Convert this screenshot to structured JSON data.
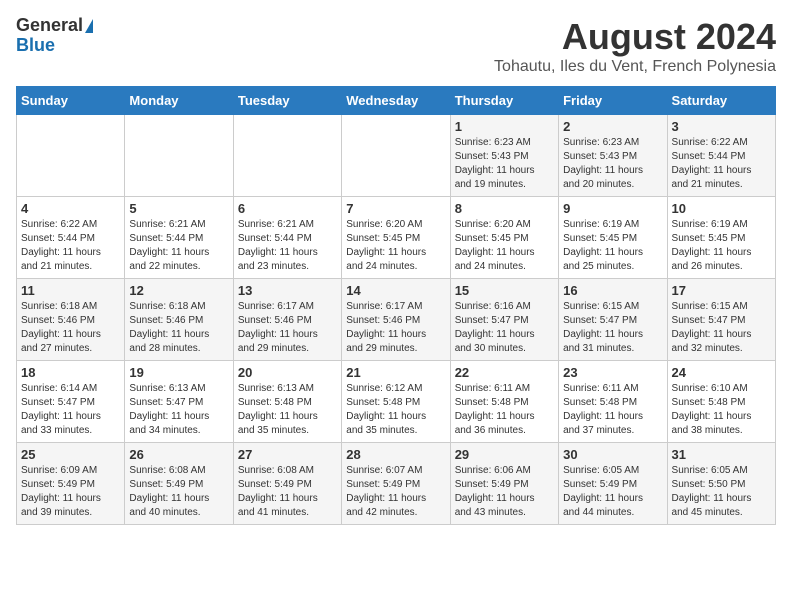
{
  "logo": {
    "general": "General",
    "blue": "Blue"
  },
  "title": "August 2024",
  "subtitle": "Tohautu, Iles du Vent, French Polynesia",
  "days": [
    "Sunday",
    "Monday",
    "Tuesday",
    "Wednesday",
    "Thursday",
    "Friday",
    "Saturday"
  ],
  "weeks": [
    [
      {
        "date": "",
        "info": ""
      },
      {
        "date": "",
        "info": ""
      },
      {
        "date": "",
        "info": ""
      },
      {
        "date": "",
        "info": ""
      },
      {
        "date": "1",
        "info": "Sunrise: 6:23 AM\nSunset: 5:43 PM\nDaylight: 11 hours\nand 19 minutes."
      },
      {
        "date": "2",
        "info": "Sunrise: 6:23 AM\nSunset: 5:43 PM\nDaylight: 11 hours\nand 20 minutes."
      },
      {
        "date": "3",
        "info": "Sunrise: 6:22 AM\nSunset: 5:44 PM\nDaylight: 11 hours\nand 21 minutes."
      }
    ],
    [
      {
        "date": "4",
        "info": "Sunrise: 6:22 AM\nSunset: 5:44 PM\nDaylight: 11 hours\nand 21 minutes."
      },
      {
        "date": "5",
        "info": "Sunrise: 6:21 AM\nSunset: 5:44 PM\nDaylight: 11 hours\nand 22 minutes."
      },
      {
        "date": "6",
        "info": "Sunrise: 6:21 AM\nSunset: 5:44 PM\nDaylight: 11 hours\nand 23 minutes."
      },
      {
        "date": "7",
        "info": "Sunrise: 6:20 AM\nSunset: 5:45 PM\nDaylight: 11 hours\nand 24 minutes."
      },
      {
        "date": "8",
        "info": "Sunrise: 6:20 AM\nSunset: 5:45 PM\nDaylight: 11 hours\nand 24 minutes."
      },
      {
        "date": "9",
        "info": "Sunrise: 6:19 AM\nSunset: 5:45 PM\nDaylight: 11 hours\nand 25 minutes."
      },
      {
        "date": "10",
        "info": "Sunrise: 6:19 AM\nSunset: 5:45 PM\nDaylight: 11 hours\nand 26 minutes."
      }
    ],
    [
      {
        "date": "11",
        "info": "Sunrise: 6:18 AM\nSunset: 5:46 PM\nDaylight: 11 hours\nand 27 minutes."
      },
      {
        "date": "12",
        "info": "Sunrise: 6:18 AM\nSunset: 5:46 PM\nDaylight: 11 hours\nand 28 minutes."
      },
      {
        "date": "13",
        "info": "Sunrise: 6:17 AM\nSunset: 5:46 PM\nDaylight: 11 hours\nand 29 minutes."
      },
      {
        "date": "14",
        "info": "Sunrise: 6:17 AM\nSunset: 5:46 PM\nDaylight: 11 hours\nand 29 minutes."
      },
      {
        "date": "15",
        "info": "Sunrise: 6:16 AM\nSunset: 5:47 PM\nDaylight: 11 hours\nand 30 minutes."
      },
      {
        "date": "16",
        "info": "Sunrise: 6:15 AM\nSunset: 5:47 PM\nDaylight: 11 hours\nand 31 minutes."
      },
      {
        "date": "17",
        "info": "Sunrise: 6:15 AM\nSunset: 5:47 PM\nDaylight: 11 hours\nand 32 minutes."
      }
    ],
    [
      {
        "date": "18",
        "info": "Sunrise: 6:14 AM\nSunset: 5:47 PM\nDaylight: 11 hours\nand 33 minutes."
      },
      {
        "date": "19",
        "info": "Sunrise: 6:13 AM\nSunset: 5:47 PM\nDaylight: 11 hours\nand 34 minutes."
      },
      {
        "date": "20",
        "info": "Sunrise: 6:13 AM\nSunset: 5:48 PM\nDaylight: 11 hours\nand 35 minutes."
      },
      {
        "date": "21",
        "info": "Sunrise: 6:12 AM\nSunset: 5:48 PM\nDaylight: 11 hours\nand 35 minutes."
      },
      {
        "date": "22",
        "info": "Sunrise: 6:11 AM\nSunset: 5:48 PM\nDaylight: 11 hours\nand 36 minutes."
      },
      {
        "date": "23",
        "info": "Sunrise: 6:11 AM\nSunset: 5:48 PM\nDaylight: 11 hours\nand 37 minutes."
      },
      {
        "date": "24",
        "info": "Sunrise: 6:10 AM\nSunset: 5:48 PM\nDaylight: 11 hours\nand 38 minutes."
      }
    ],
    [
      {
        "date": "25",
        "info": "Sunrise: 6:09 AM\nSunset: 5:49 PM\nDaylight: 11 hours\nand 39 minutes."
      },
      {
        "date": "26",
        "info": "Sunrise: 6:08 AM\nSunset: 5:49 PM\nDaylight: 11 hours\nand 40 minutes."
      },
      {
        "date": "27",
        "info": "Sunrise: 6:08 AM\nSunset: 5:49 PM\nDaylight: 11 hours\nand 41 minutes."
      },
      {
        "date": "28",
        "info": "Sunrise: 6:07 AM\nSunset: 5:49 PM\nDaylight: 11 hours\nand 42 minutes."
      },
      {
        "date": "29",
        "info": "Sunrise: 6:06 AM\nSunset: 5:49 PM\nDaylight: 11 hours\nand 43 minutes."
      },
      {
        "date": "30",
        "info": "Sunrise: 6:05 AM\nSunset: 5:49 PM\nDaylight: 11 hours\nand 44 minutes."
      },
      {
        "date": "31",
        "info": "Sunrise: 6:05 AM\nSunset: 5:50 PM\nDaylight: 11 hours\nand 45 minutes."
      }
    ]
  ]
}
